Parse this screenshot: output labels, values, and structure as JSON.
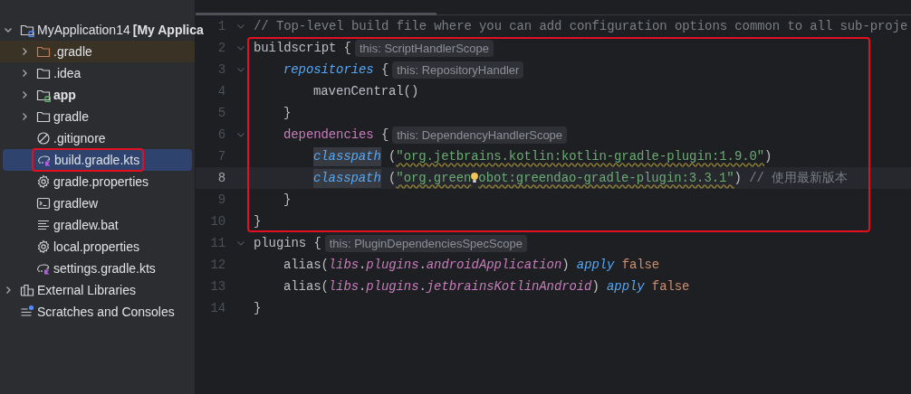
{
  "project_tree": [
    {
      "label": "MyApplication14",
      "suffix": "[My Applica",
      "kind": "project",
      "expanded": true,
      "selected": false,
      "excluded": false,
      "boxed": false,
      "children": [
        {
          "label": ".gradle",
          "kind": "folder",
          "expanded": false,
          "selected": false,
          "excluded": true,
          "boxed": false,
          "bold": false
        },
        {
          "label": ".idea",
          "kind": "folder",
          "expanded": false,
          "selected": false,
          "excluded": false,
          "boxed": false,
          "bold": false
        },
        {
          "label": "app",
          "kind": "module",
          "expanded": false,
          "selected": false,
          "excluded": false,
          "boxed": false,
          "bold": true
        },
        {
          "label": "gradle",
          "kind": "folder",
          "expanded": false,
          "selected": false,
          "excluded": false,
          "boxed": false,
          "bold": false
        },
        {
          "label": ".gitignore",
          "kind": "ignore",
          "selected": false,
          "excluded": false,
          "boxed": false,
          "bold": false
        },
        {
          "label": "build.gradle.kts",
          "kind": "gradle",
          "selected": true,
          "excluded": false,
          "boxed": true,
          "bold": false
        },
        {
          "label": "gradle.properties",
          "kind": "properties",
          "selected": false,
          "excluded": false,
          "boxed": false,
          "bold": false
        },
        {
          "label": "gradlew",
          "kind": "script",
          "selected": false,
          "excluded": false,
          "boxed": false,
          "bold": false
        },
        {
          "label": "gradlew.bat",
          "kind": "text",
          "selected": false,
          "excluded": false,
          "boxed": false,
          "bold": false
        },
        {
          "label": "local.properties",
          "kind": "properties",
          "selected": false,
          "excluded": false,
          "boxed": false,
          "bold": false
        },
        {
          "label": "settings.gradle.kts",
          "kind": "gradle",
          "selected": false,
          "excluded": false,
          "boxed": false,
          "bold": false
        }
      ]
    },
    {
      "label": "External Libraries",
      "kind": "library",
      "expanded": false,
      "selected": false,
      "excluded": false,
      "boxed": false
    },
    {
      "label": "Scratches and Consoles",
      "kind": "scratches",
      "selected": false,
      "excluded": false,
      "boxed": false
    }
  ],
  "editor": {
    "blocks": [
      {
        "highlighted": false,
        "lines": [
          {
            "number": "1",
            "foldable": true,
            "current": false,
            "tokens": [
              {
                "kind": "comment",
                "text": "// Top-level build file where you can add configuration options common to all sub-proje"
              }
            ]
          }
        ]
      },
      {
        "highlighted": true,
        "lines": [
          {
            "number": "2",
            "foldable": true,
            "current": false,
            "tokens": [
              {
                "kind": "plain",
                "text": "buildscript {"
              },
              {
                "kind": "hint",
                "text": "this: ScriptHandlerScope"
              }
            ],
            "children": [
              {
                "number": "3",
                "foldable": true,
                "current": false,
                "tokens": [
                  {
                    "kind": "call",
                    "text": "repositories"
                  },
                  {
                    "kind": "plain",
                    "text": " {"
                  },
                  {
                    "kind": "hint",
                    "text": "this: RepositoryHandler"
                  }
                ],
                "children": [
                  {
                    "number": "4",
                    "foldable": false,
                    "current": false,
                    "tokens": [
                      {
                        "kind": "plain",
                        "text": "mavenCentral()"
                      }
                    ]
                  }
                ]
              },
              {
                "number": "5",
                "foldable": false,
                "current": false,
                "tokens": [
                  {
                    "kind": "plain",
                    "text": "}"
                  }
                ]
              },
              {
                "number": "6",
                "foldable": true,
                "current": false,
                "tokens": [
                  {
                    "kind": "member",
                    "text": "dependencies"
                  },
                  {
                    "kind": "plain",
                    "text": " {"
                  },
                  {
                    "kind": "hint",
                    "text": "this: DependencyHandlerScope"
                  }
                ],
                "children": [
                  {
                    "number": "7",
                    "foldable": false,
                    "current": false,
                    "tokens": [
                      {
                        "kind": "call_marked",
                        "text": "classpath"
                      },
                      {
                        "kind": "plain",
                        "text": " ("
                      },
                      {
                        "kind": "string",
                        "text": "\"org.jetbrains.kotlin:kotlin-gradle-plugin:1.9.0\""
                      },
                      {
                        "kind": "plain",
                        "text": ")"
                      }
                    ]
                  },
                  {
                    "number": "8",
                    "foldable": false,
                    "current": true,
                    "tokens": [
                      {
                        "kind": "call_marked",
                        "text": "classpath"
                      },
                      {
                        "kind": "plain",
                        "text": " ("
                      },
                      {
                        "kind": "string",
                        "text": "\"org.green"
                      },
                      {
                        "kind": "bulb"
                      },
                      {
                        "kind": "string",
                        "text": "obot:greendao-gradle-plugin:3.3.1\""
                      },
                      {
                        "kind": "plain",
                        "text": ")"
                      },
                      {
                        "kind": "comment",
                        "text": " // 使用最新版本"
                      }
                    ]
                  }
                ]
              },
              {
                "number": "9",
                "foldable": false,
                "current": false,
                "tokens": [
                  {
                    "kind": "plain",
                    "text": "}"
                  }
                ]
              }
            ]
          },
          {
            "number": "10",
            "foldable": false,
            "current": false,
            "tokens": [
              {
                "kind": "plain",
                "text": "}"
              }
            ]
          }
        ]
      },
      {
        "highlighted": false,
        "lines": [
          {
            "number": "11",
            "foldable": true,
            "current": false,
            "tokens": [
              {
                "kind": "plain",
                "text": "plugins {"
              },
              {
                "kind": "hint",
                "text": "this: PluginDependenciesSpecScope"
              }
            ],
            "children": [
              {
                "number": "12",
                "foldable": false,
                "current": false,
                "tokens": [
                  {
                    "kind": "plain",
                    "text": "alias("
                  },
                  {
                    "kind": "member_italic",
                    "text": "libs"
                  },
                  {
                    "kind": "plain",
                    "text": "."
                  },
                  {
                    "kind": "member_italic",
                    "text": "plugins"
                  },
                  {
                    "kind": "plain",
                    "text": "."
                  },
                  {
                    "kind": "member_italic",
                    "text": "androidApplication"
                  },
                  {
                    "kind": "plain",
                    "text": ") "
                  },
                  {
                    "kind": "call",
                    "text": "apply"
                  },
                  {
                    "kind": "keyword",
                    "text": " false"
                  }
                ]
              },
              {
                "number": "13",
                "foldable": false,
                "current": false,
                "tokens": [
                  {
                    "kind": "plain",
                    "text": "alias("
                  },
                  {
                    "kind": "member_italic",
                    "text": "libs"
                  },
                  {
                    "kind": "plain",
                    "text": "."
                  },
                  {
                    "kind": "member_italic",
                    "text": "plugins"
                  },
                  {
                    "kind": "plain",
                    "text": "."
                  },
                  {
                    "kind": "member_italic",
                    "text": "jetbrainsKotlinAndroid"
                  },
                  {
                    "kind": "plain",
                    "text": ") "
                  },
                  {
                    "kind": "call",
                    "text": "apply"
                  },
                  {
                    "kind": "keyword",
                    "text": " false"
                  }
                ]
              }
            ]
          },
          {
            "number": "14",
            "foldable": false,
            "current": false,
            "tokens": [
              {
                "kind": "plain",
                "text": "}"
              }
            ]
          }
        ]
      }
    ]
  }
}
